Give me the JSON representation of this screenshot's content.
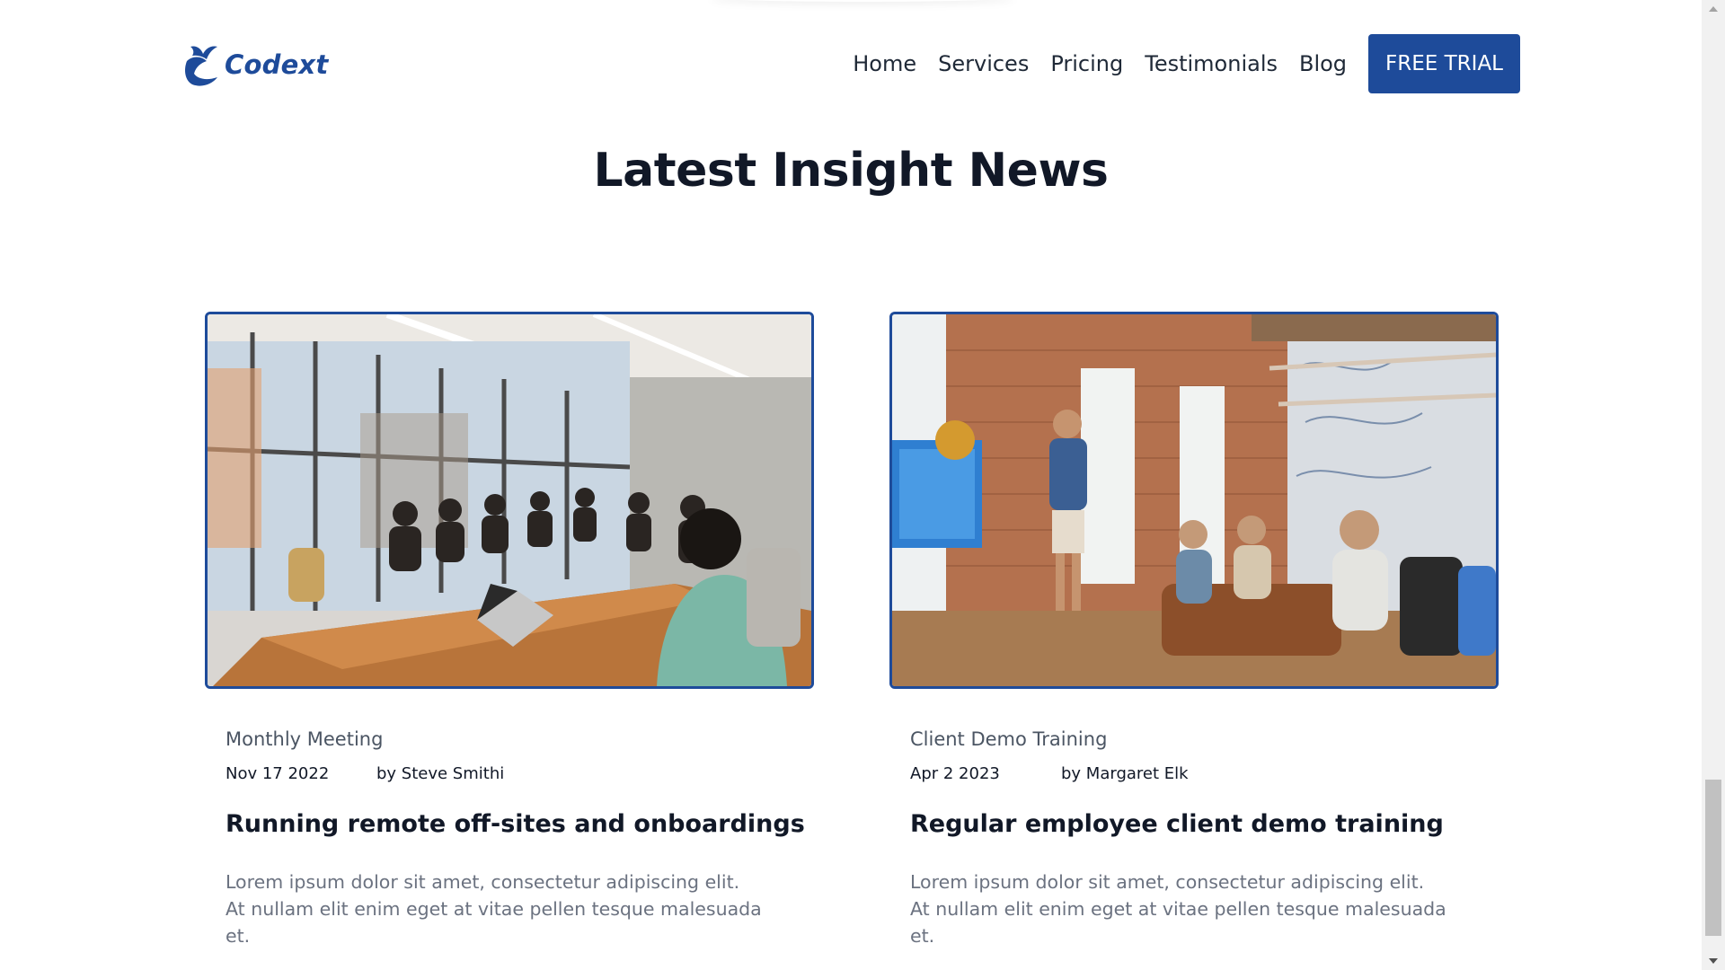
{
  "header": {
    "logo_text": "Codext",
    "nav": [
      "Home",
      "Services",
      "Pricing",
      "Testimonials",
      "Blog"
    ],
    "cta_label": "FREE TRIAL"
  },
  "section": {
    "title": "Latest Insight News"
  },
  "posts": [
    {
      "image": "conference-room-meeting-photo",
      "category": "Monthly Meeting",
      "date": "Nov 17 2022",
      "author": "by Steve Smithi",
      "title": "Running remote off-sites and onboardings",
      "excerpt": "Lorem ipsum dolor sit amet, consectetur adipiscing elit. At nullam elit enim eget at vitae pellen tesque malesuada et."
    },
    {
      "image": "office-presentation-photo",
      "category": "Client Demo Training",
      "date": "Apr 2 2023",
      "author": "by Margaret Elk",
      "title": "Regular employee client demo training",
      "excerpt": "Lorem ipsum dolor sit amet, consectetur adipiscing elit. At nullam elit enim eget at vitae pellen tesque malesuada et."
    }
  ],
  "colors": {
    "brand": "#1e4b9a",
    "heading": "#111827",
    "muted": "#6b7280"
  }
}
